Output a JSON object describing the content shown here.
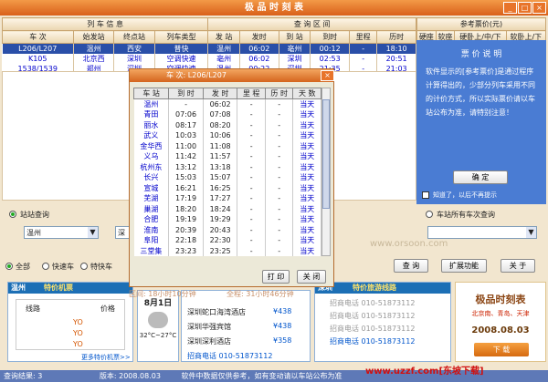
{
  "window": {
    "title": "极 品 时 刻 表",
    "close": "×",
    "max": "□",
    "min": "_"
  },
  "header": {
    "group_train": "列 车 信 息",
    "group_query": "查 询 区 间",
    "group_fare": "参考票价(元)",
    "cols": [
      "车 次",
      "始发站",
      "终点站",
      "列车类型",
      "发 站",
      "发时",
      "到 站",
      "到时",
      "里程",
      "历时"
    ],
    "fare_cols": [
      "硬座",
      "软座",
      "硬卧上/中/下",
      "软卧上/下"
    ]
  },
  "rows": [
    [
      "L206/L207",
      "温州",
      "西安",
      "普快",
      "温州",
      "06:02",
      "亳州",
      "00:12",
      "-",
      "18:10"
    ],
    [
      "K105",
      "北京西",
      "深圳",
      "空调快速",
      "亳州",
      "06:02",
      "深圳",
      "02:53",
      "-",
      "20:51"
    ],
    [
      "1538/1539",
      "郑州",
      "深圳",
      "空调快速",
      "温州",
      "00:22",
      "深圳",
      "21:35",
      "-",
      "21:03"
    ]
  ],
  "fare_panel": {
    "title": "票 价 说 明",
    "text": "软件显示的[参考票价]是通过程序计算得出的，少部分列车采用不同的计价方式，所以实际票价请以车站公布为准，请特别注意！",
    "ok": "确 定",
    "nomore": "知道了，以后不再提示"
  },
  "dialog": {
    "title": "车 次: L206/L207",
    "cols": [
      "车 站",
      "到 时",
      "发 时",
      "里 程",
      "历 时",
      "天 数"
    ],
    "rows": [
      [
        "温州",
        "-",
        "06:02",
        "-",
        "-",
        "当天"
      ],
      [
        "青田",
        "07:06",
        "07:08",
        "-",
        "-",
        "当天"
      ],
      [
        "丽水",
        "08:17",
        "08:20",
        "-",
        "-",
        "当天"
      ],
      [
        "武义",
        "10:03",
        "10:06",
        "-",
        "-",
        "当天"
      ],
      [
        "金华西",
        "11:00",
        "11:08",
        "-",
        "-",
        "当天"
      ],
      [
        "义乌",
        "11:42",
        "11:57",
        "-",
        "-",
        "当天"
      ],
      [
        "杭州东",
        "13:12",
        "13:18",
        "-",
        "-",
        "当天"
      ],
      [
        "长兴",
        "15:03",
        "15:07",
        "-",
        "-",
        "当天"
      ],
      [
        "宣城",
        "16:21",
        "16:25",
        "-",
        "-",
        "当天"
      ],
      [
        "芜湖",
        "17:19",
        "17:27",
        "-",
        "-",
        "当天"
      ],
      [
        "巢湖",
        "18:20",
        "18:24",
        "-",
        "-",
        "当天"
      ],
      [
        "合肥",
        "19:19",
        "19:29",
        "-",
        "-",
        "当天"
      ],
      [
        "淮南",
        "20:39",
        "20:43",
        "-",
        "-",
        "当天"
      ],
      [
        "阜阳",
        "22:18",
        "22:30",
        "-",
        "-",
        "当天"
      ],
      [
        "三堂集",
        "23:23",
        "23:25",
        "-",
        "-",
        "当天"
      ]
    ],
    "print": "打 印",
    "close": "关 闭"
  },
  "query": {
    "station_query": "站站查询",
    "from_value": "温州",
    "to_value": "深",
    "all_trains": "车站所有车次查询",
    "watermark": "www.orsoon.com"
  },
  "filters": {
    "all": "全部",
    "express": "快速车",
    "special": "特快车"
  },
  "buttons": {
    "query": "查 询",
    "ext": "扩展功能",
    "close": "关 于"
  },
  "ads": {
    "flight_title": "特价机票",
    "city": "温州",
    "route": "线路",
    "price": "价格",
    "yo": "YO",
    "more": "更多特价机票>>",
    "weather_date": "8月1日",
    "weather_temp": "32°C~27°C",
    "hotels": [
      [
        "深圳蛇口海湾酒店",
        "¥438"
      ],
      [
        "深圳华强宾馆",
        "¥438"
      ],
      [
        "深圳深利酒店",
        "¥358"
      ]
    ],
    "hotline": "招商电话 010-51873112",
    "tour_city": "深圳",
    "tour_title": "特价旅游线路",
    "tour_lines": [
      "招商电话 010-51873112",
      "招商电话 010-51873112",
      "招商电话 010-51873112",
      "招商电话 010-51873112"
    ],
    "brand": "极品时刻表",
    "brand_sub": "北京南、青岛、天津",
    "brand_date": "2008.08.03",
    "download": "下 载"
  },
  "mid_status": {
    "left": "区间: 18小时10分钟",
    "right": "全程: 31小时46分钟"
  },
  "status": {
    "a": "查询结果: 3",
    "b": "版本: 2008.08.03",
    "c": "软件中数据仅供参考，如有变动请以车站公布为准",
    "watermark": "www.uzzf.com[东坡下载]"
  }
}
